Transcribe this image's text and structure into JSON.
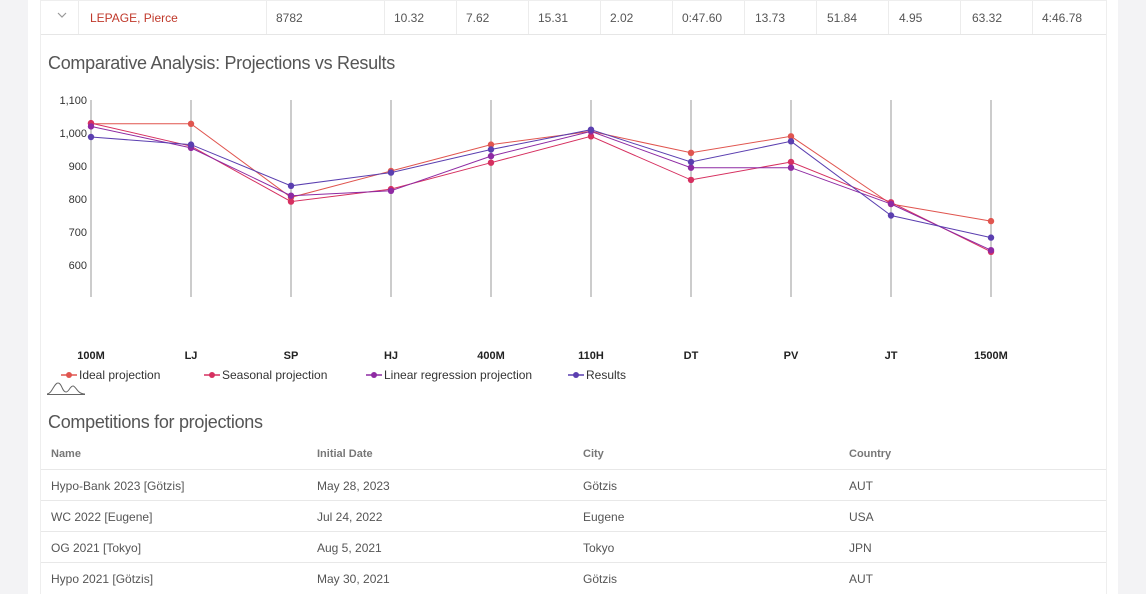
{
  "athlete_row": {
    "name": "LEPAGE, Pierce",
    "total": "8782",
    "marks": [
      "10.32",
      "7.62",
      "15.31",
      "2.02",
      "0:47.60",
      "13.73",
      "51.84",
      "4.95",
      "63.32",
      "4:46.78"
    ]
  },
  "chart_section": {
    "title": "Comparative Analysis: Projections vs Results"
  },
  "chart_data": {
    "type": "line",
    "categories": [
      "100M",
      "LJ",
      "SP",
      "HJ",
      "400M",
      "110H",
      "DT",
      "PV",
      "JT",
      "1500M"
    ],
    "ylim": [
      600,
      1100
    ],
    "yticks": [
      "600",
      "700",
      "800",
      "900",
      "1,000",
      "1,100"
    ],
    "grid": "vertical",
    "legend_position": "bottom-left",
    "series": [
      {
        "name": "Ideal projection",
        "color": "#e0554f",
        "values": [
          1028,
          1028,
          805,
          885,
          965,
          1005,
          940,
          990,
          785,
          733
        ]
      },
      {
        "name": "Seasonal projection",
        "color": "#d63060",
        "values": [
          1030,
          960,
          792,
          830,
          910,
          990,
          858,
          912,
          790,
          640
        ]
      },
      {
        "name": "Linear regression projection",
        "color": "#8e2aa3",
        "values": [
          1020,
          955,
          810,
          825,
          930,
          1005,
          895,
          895,
          785,
          645
        ]
      },
      {
        "name": "Results",
        "color": "#5b3fb0",
        "values": [
          988,
          965,
          840,
          880,
          950,
          1010,
          912,
          975,
          750,
          683
        ]
      }
    ]
  },
  "competitions": {
    "title": "Competitions for projections",
    "columns": [
      "Name",
      "Initial Date",
      "City",
      "Country"
    ],
    "rows": [
      [
        "Hypo-Bank 2023 [Götzis]",
        "May 28, 2023",
        "Götzis",
        "AUT"
      ],
      [
        "WC 2022 [Eugene]",
        "Jul 24, 2022",
        "Eugene",
        "USA"
      ],
      [
        "OG 2021 [Tokyo]",
        "Aug 5, 2021",
        "Tokyo",
        "JPN"
      ],
      [
        "Hypo 2021 [Götzis]",
        "May 30, 2021",
        "Götzis",
        "AUT"
      ]
    ]
  },
  "icons": {
    "expand": "chevron-down-icon",
    "chart_toggle": "bell-curve-icon"
  }
}
